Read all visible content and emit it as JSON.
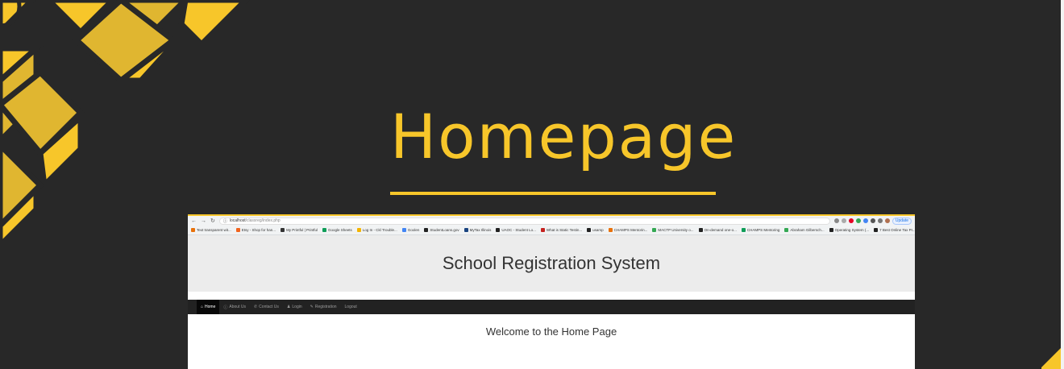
{
  "slide": {
    "title": "Homepage",
    "accent_color": "#f7c62a",
    "background_color": "#282828"
  },
  "browser": {
    "url_host": "localhost",
    "url_path": "/classreg/index.php",
    "update_label": "Update",
    "bookmarks": [
      {
        "label": "Text transparent wit...",
        "color": "#e8710a"
      },
      {
        "label": "Etsy - Shop for han...",
        "color": "#f1641e"
      },
      {
        "label": "My Printful | Printful",
        "color": "#333333"
      },
      {
        "label": "Google Sheets",
        "color": "#0f9d58"
      },
      {
        "label": "Log In - Ckl Trouble...",
        "color": "#f4b400"
      },
      {
        "label": "Goolen",
        "color": "#4285f4"
      },
      {
        "label": "StudentLoans.gov",
        "color": "#222222"
      },
      {
        "label": "MyTax Illinois",
        "color": "#1a4480"
      },
      {
        "label": "UAOC - Student Lo...",
        "color": "#222222"
      },
      {
        "label": "What is Static Testin...",
        "color": "#c5221f"
      },
      {
        "label": "usamp",
        "color": "#222222"
      },
      {
        "label": "CHAMPS Mentorin...",
        "color": "#e8710a"
      },
      {
        "label": "MACTP University o...",
        "color": "#34a853"
      },
      {
        "label": "On-demand one-o...",
        "color": "#222222"
      },
      {
        "label": "CHAMPS Mentoring",
        "color": "#0f9d58"
      },
      {
        "label": "Abraham Gilbersch...",
        "color": "#34a853"
      },
      {
        "label": "Operating System (...",
        "color": "#222222"
      },
      {
        "label": "7 Best Online Tax Pr...",
        "color": "#222222"
      }
    ]
  },
  "site": {
    "title": "School Registration System",
    "nav": [
      {
        "icon": "home-icon",
        "glyph": "⌂",
        "label": "Home",
        "active": true
      },
      {
        "icon": "info-icon",
        "glyph": "ⓘ",
        "label": "About Us",
        "active": false
      },
      {
        "icon": "phone-icon",
        "glyph": "✆",
        "label": "Contact Us",
        "active": false
      },
      {
        "icon": "user-icon",
        "glyph": "♟",
        "label": "Login",
        "active": false
      },
      {
        "icon": "pencil-icon",
        "glyph": "✎",
        "label": "Registration",
        "active": false
      },
      {
        "icon": "",
        "glyph": "",
        "label": "Logout",
        "active": false
      }
    ],
    "welcome": "Welcome to the Home Page"
  }
}
